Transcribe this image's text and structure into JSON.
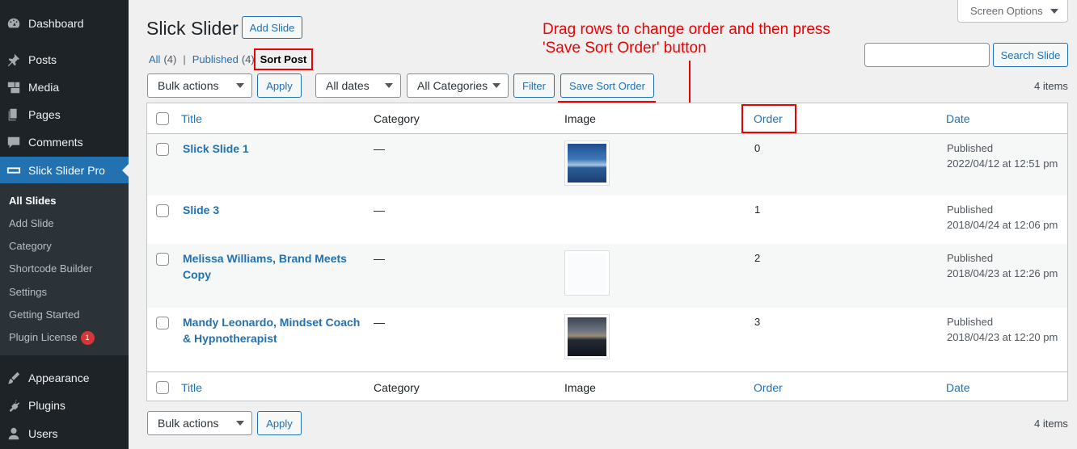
{
  "sidebar": {
    "menu": [
      {
        "label": "Dashboard",
        "icon": "dashboard-icon"
      },
      {
        "label": "Posts",
        "icon": "pin-icon"
      },
      {
        "label": "Media",
        "icon": "media-icon"
      },
      {
        "label": "Pages",
        "icon": "pages-icon"
      },
      {
        "label": "Comments",
        "icon": "comment-icon"
      },
      {
        "label": "Slick Slider Pro",
        "icon": "slider-icon"
      },
      {
        "label": "Appearance",
        "icon": "brush-icon"
      },
      {
        "label": "Plugins",
        "icon": "plugin-icon"
      },
      {
        "label": "Users",
        "icon": "user-icon"
      }
    ],
    "submenu": [
      "All Slides",
      "Add Slide",
      "Category",
      "Shortcode Builder",
      "Settings",
      "Getting Started",
      "Plugin License"
    ],
    "license_badge": "1"
  },
  "header": {
    "title": "Slick Slider",
    "add_button": "Add Slide",
    "screen_options": "Screen Options"
  },
  "filters": {
    "all_label": "All",
    "all_count": "(4)",
    "published_label": "Published",
    "published_count": "(4)",
    "sort_post": "Sort Post"
  },
  "toolbar": {
    "bulk_actions": "Bulk actions",
    "apply": "Apply",
    "all_dates": "All dates",
    "all_categories": "All Categories",
    "filter": "Filter",
    "save_sort_order": "Save Sort Order",
    "items_count": "4 items"
  },
  "search": {
    "button": "Search Slide",
    "value": ""
  },
  "annotation": {
    "line1": "Drag rows to change order and then press",
    "line2": "'Save Sort Order' button"
  },
  "table": {
    "columns": {
      "title": "Title",
      "category": "Category",
      "image": "Image",
      "order": "Order",
      "date": "Date"
    },
    "rows": [
      {
        "title_line1": "Slick Slide 1",
        "title_line2": "",
        "category": "—",
        "order": "0",
        "status": "Published",
        "date": "2022/04/12 at 12:51 pm",
        "image": "blue-water-thumbnail"
      },
      {
        "title_line1": "Slide 3",
        "title_line2": "",
        "category": "—",
        "order": "1",
        "status": "Published",
        "date": "2018/04/24 at 12:06 pm",
        "image": ""
      },
      {
        "title_line1": "Melissa Williams, Brand Meets",
        "title_line2": "Copy",
        "category": "—",
        "order": "2",
        "status": "Published",
        "date": "2018/04/23 at 12:26 pm",
        "image": "white-thumbnail"
      },
      {
        "title_line1": "Mandy Leonardo, Mindset Coach",
        "title_line2": "& Hypnotherapist",
        "category": "—",
        "order": "3",
        "status": "Published",
        "date": "2018/04/23 at 12:20 pm",
        "image": "dusk-sea-thumbnail"
      }
    ]
  },
  "colors": {
    "accent": "#2271b1",
    "sidebar": "#1d2327",
    "annotation": "#ee0000"
  }
}
